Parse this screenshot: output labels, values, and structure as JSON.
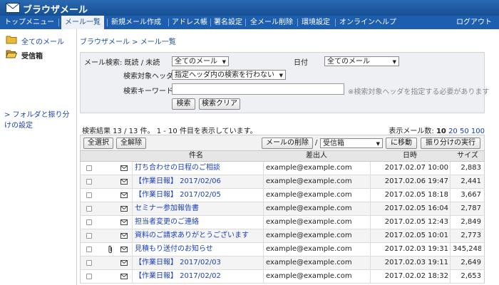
{
  "app": {
    "title": "ブラウザメール"
  },
  "nav": {
    "items": [
      {
        "label": "トップメニュー",
        "active": false
      },
      {
        "label": "メール一覧",
        "active": true
      },
      {
        "label": "新規メール作成",
        "active": false
      },
      {
        "label": "アドレス帳",
        "active": false
      },
      {
        "label": "署名設定",
        "active": false
      },
      {
        "label": "全メール削除",
        "active": false
      },
      {
        "label": "環境設定",
        "active": false
      },
      {
        "label": "オンラインヘルプ",
        "active": false
      }
    ],
    "logout": "ログアウト"
  },
  "sidebar": {
    "all_mail": "全てのメール",
    "inbox": "受信箱",
    "folder_link": "> フォルダと振り分けの設定"
  },
  "breadcrumb": "ブラウザメール > メール一覧",
  "search": {
    "label_status": "メール検索: 既読 / 未読",
    "status_value": "全てのメール",
    "label_date": "日付",
    "date_value": "全てのメール",
    "label_header": "検索対象ヘッダ",
    "header_value": "指定ヘッダ内の検索を行わない",
    "label_keyword": "検索キーワード",
    "keyword_value": "",
    "note": "※検索対象ヘッダを指定する必要があります",
    "search_button": "検索",
    "clear_button": "検索クリア"
  },
  "results": {
    "info": "検索結果 13 / 13 件。 1 - 10 件目を表示しています。",
    "per_page_label": "表示メール数:",
    "per_page_current": "10",
    "per_page_options": [
      "20",
      "50",
      "100"
    ]
  },
  "toolbar": {
    "select_all": "全選択",
    "deselect_all": "全解除",
    "delete": "メールの削除",
    "slash": "/",
    "folder_value": "受信箱",
    "move": "に移動",
    "filter": "振り分けの実行"
  },
  "table": {
    "headers": {
      "subject": "件名",
      "from": "差出人",
      "date": "日時",
      "size": "サイズ"
    },
    "rows": [
      {
        "subject": "打ち合わせの日程のご相談",
        "from": "example@example.com",
        "date": "2017.02.07 10:00",
        "size": "2,883",
        "attach": false
      },
      {
        "subject": "【作業日報】 2017/02/06",
        "from": "example@example.com",
        "date": "2017.02.06 19:47",
        "size": "2,441",
        "attach": false
      },
      {
        "subject": "【作業日報】 2017/02/05",
        "from": "example@example.com",
        "date": "2017.02.05 18:18",
        "size": "3,667",
        "attach": false
      },
      {
        "subject": "セミナー参加報告書",
        "from": "example@example.com",
        "date": "2017.02.05 16:04",
        "size": "2,787",
        "attach": false
      },
      {
        "subject": "担当者変更のご連絡",
        "from": "example@example.com",
        "date": "2017.02.05 12:43",
        "size": "2,849",
        "attach": false
      },
      {
        "subject": "資料のご請求ありがとうございます",
        "from": "example@example.com",
        "date": "2017.02.05 10:01",
        "size": "2,773",
        "attach": false
      },
      {
        "subject": "見積もり送付のお知らせ",
        "from": "example@example.com",
        "date": "2017.02.03 19:31",
        "size": "345,248",
        "attach": true
      },
      {
        "subject": "【作業日報】 2017/02/03",
        "from": "example@example.com",
        "date": "2017.02.03 19:11",
        "size": "2,649",
        "attach": false
      },
      {
        "subject": "【作業日報】 2017/02/02",
        "from": "example@example.com",
        "date": "2017.02.02 18:32",
        "size": "2,653",
        "attach": false
      }
    ]
  }
}
